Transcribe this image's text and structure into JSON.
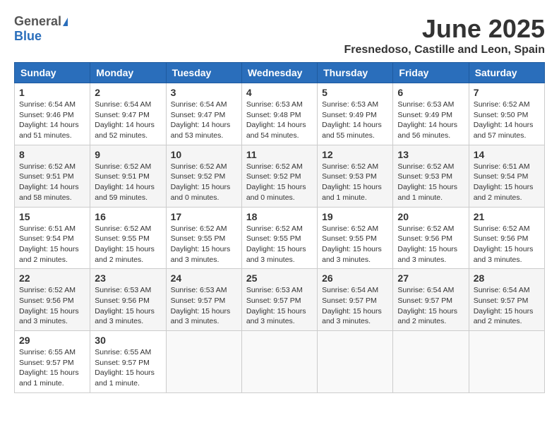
{
  "header": {
    "logo_general": "General",
    "logo_blue": "Blue",
    "month": "June 2025",
    "location": "Fresnedoso, Castille and Leon, Spain"
  },
  "days_of_week": [
    "Sunday",
    "Monday",
    "Tuesday",
    "Wednesday",
    "Thursday",
    "Friday",
    "Saturday"
  ],
  "weeks": [
    [
      {
        "day": "1",
        "sunrise": "6:54 AM",
        "sunset": "9:46 PM",
        "daylight": "14 hours and 51 minutes."
      },
      {
        "day": "2",
        "sunrise": "6:54 AM",
        "sunset": "9:47 PM",
        "daylight": "14 hours and 52 minutes."
      },
      {
        "day": "3",
        "sunrise": "6:54 AM",
        "sunset": "9:47 PM",
        "daylight": "14 hours and 53 minutes."
      },
      {
        "day": "4",
        "sunrise": "6:53 AM",
        "sunset": "9:48 PM",
        "daylight": "14 hours and 54 minutes."
      },
      {
        "day": "5",
        "sunrise": "6:53 AM",
        "sunset": "9:49 PM",
        "daylight": "14 hours and 55 minutes."
      },
      {
        "day": "6",
        "sunrise": "6:53 AM",
        "sunset": "9:49 PM",
        "daylight": "14 hours and 56 minutes."
      },
      {
        "day": "7",
        "sunrise": "6:52 AM",
        "sunset": "9:50 PM",
        "daylight": "14 hours and 57 minutes."
      }
    ],
    [
      {
        "day": "8",
        "sunrise": "6:52 AM",
        "sunset": "9:51 PM",
        "daylight": "14 hours and 58 minutes."
      },
      {
        "day": "9",
        "sunrise": "6:52 AM",
        "sunset": "9:51 PM",
        "daylight": "14 hours and 59 minutes."
      },
      {
        "day": "10",
        "sunrise": "6:52 AM",
        "sunset": "9:52 PM",
        "daylight": "15 hours and 0 minutes."
      },
      {
        "day": "11",
        "sunrise": "6:52 AM",
        "sunset": "9:52 PM",
        "daylight": "15 hours and 0 minutes."
      },
      {
        "day": "12",
        "sunrise": "6:52 AM",
        "sunset": "9:53 PM",
        "daylight": "15 hours and 1 minute."
      },
      {
        "day": "13",
        "sunrise": "6:52 AM",
        "sunset": "9:53 PM",
        "daylight": "15 hours and 1 minute."
      },
      {
        "day": "14",
        "sunrise": "6:51 AM",
        "sunset": "9:54 PM",
        "daylight": "15 hours and 2 minutes."
      }
    ],
    [
      {
        "day": "15",
        "sunrise": "6:51 AM",
        "sunset": "9:54 PM",
        "daylight": "15 hours and 2 minutes."
      },
      {
        "day": "16",
        "sunrise": "6:52 AM",
        "sunset": "9:55 PM",
        "daylight": "15 hours and 2 minutes."
      },
      {
        "day": "17",
        "sunrise": "6:52 AM",
        "sunset": "9:55 PM",
        "daylight": "15 hours and 3 minutes."
      },
      {
        "day": "18",
        "sunrise": "6:52 AM",
        "sunset": "9:55 PM",
        "daylight": "15 hours and 3 minutes."
      },
      {
        "day": "19",
        "sunrise": "6:52 AM",
        "sunset": "9:55 PM",
        "daylight": "15 hours and 3 minutes."
      },
      {
        "day": "20",
        "sunrise": "6:52 AM",
        "sunset": "9:56 PM",
        "daylight": "15 hours and 3 minutes."
      },
      {
        "day": "21",
        "sunrise": "6:52 AM",
        "sunset": "9:56 PM",
        "daylight": "15 hours and 3 minutes."
      }
    ],
    [
      {
        "day": "22",
        "sunrise": "6:52 AM",
        "sunset": "9:56 PM",
        "daylight": "15 hours and 3 minutes."
      },
      {
        "day": "23",
        "sunrise": "6:53 AM",
        "sunset": "9:56 PM",
        "daylight": "15 hours and 3 minutes."
      },
      {
        "day": "24",
        "sunrise": "6:53 AM",
        "sunset": "9:57 PM",
        "daylight": "15 hours and 3 minutes."
      },
      {
        "day": "25",
        "sunrise": "6:53 AM",
        "sunset": "9:57 PM",
        "daylight": "15 hours and 3 minutes."
      },
      {
        "day": "26",
        "sunrise": "6:54 AM",
        "sunset": "9:57 PM",
        "daylight": "15 hours and 3 minutes."
      },
      {
        "day": "27",
        "sunrise": "6:54 AM",
        "sunset": "9:57 PM",
        "daylight": "15 hours and 2 minutes."
      },
      {
        "day": "28",
        "sunrise": "6:54 AM",
        "sunset": "9:57 PM",
        "daylight": "15 hours and 2 minutes."
      }
    ],
    [
      {
        "day": "29",
        "sunrise": "6:55 AM",
        "sunset": "9:57 PM",
        "daylight": "15 hours and 1 minute."
      },
      {
        "day": "30",
        "sunrise": "6:55 AM",
        "sunset": "9:57 PM",
        "daylight": "15 hours and 1 minute."
      },
      null,
      null,
      null,
      null,
      null
    ]
  ],
  "labels": {
    "sunrise": "Sunrise:",
    "sunset": "Sunset:",
    "daylight": "Daylight:"
  }
}
